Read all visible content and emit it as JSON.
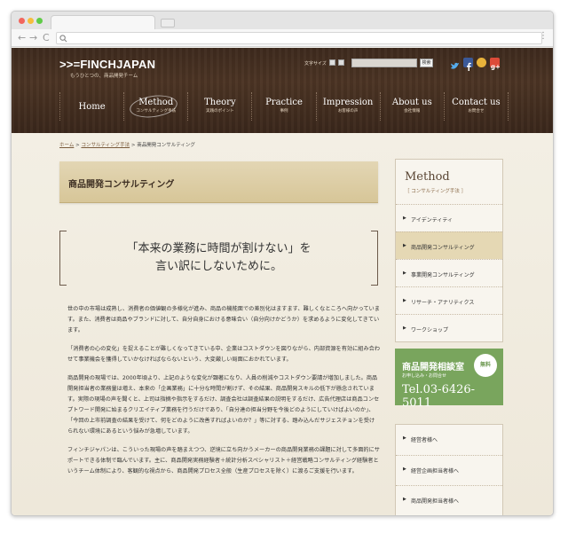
{
  "browser": {
    "back": "←",
    "forward": "→",
    "reload": "C"
  },
  "header": {
    "logo": ">>=FINCHJAPAN",
    "logo_sub": "もうひとつの、商品開発チーム",
    "font_size_label": "文字サイズ",
    "search_button": "検索",
    "nav": [
      {
        "en": "Home",
        "ja": ""
      },
      {
        "en": "Method",
        "ja": "コンサルティング手法"
      },
      {
        "en": "Theory",
        "ja": "実践のポイント"
      },
      {
        "en": "Practice",
        "ja": "事例"
      },
      {
        "en": "Impression",
        "ja": "お客様の声"
      },
      {
        "en": "About us",
        "ja": "会社情報"
      },
      {
        "en": "Contact us",
        "ja": "お問合せ"
      }
    ]
  },
  "breadcrumb": {
    "home": "ホーム",
    "sep1": " > ",
    "parent": "コンサルティング手法",
    "sep2": " > ",
    "current": "商品開発コンサルティング"
  },
  "main": {
    "title": "商品開発コンサルティング",
    "quote_line1": "「本来の業務に時間が割けない」を",
    "quote_line2": "言い訳にしないために。",
    "paragraphs": [
      "世の中の市場は成熟し、消費者の価値観の多様化が進み、商品の機能面での差別化はますます、難しくなところへ向かっています。また、消費者は商品やブランドに対して、自分自身における意味合い（自分向けかどうか）を求めるように変化してきています。",
      "「消費者の心の変化」を捉えることが難しくなってきている中、企業はコストダウンを図りながら、内部資源を有効に組み合わせて事業機会を獲得していかなければならないという、大変厳しい局面におかれています。",
      "商品開発の現場では、2000年頃より、上記のような変化が顕著になり、人員の削減やコストダウン要請が増加しました。商品開発担当者の業務量は増え、本来の「企画業務」に十分な時間が割けず、その結果、商品開発スキルの低下が懸念されています。実際の現場の声を聞くと、上司は指摘や指示をするだけ、調査会社は調査結果の説明をするだけ、広告代理店は商品コンセプトワード開発に始まるクリエイティブ業務を行うだけであり、「自分達の担当分野を今後どのようにしていけばよいのか」、「今回の上市前調査の結果を受けて、何をどのように改善すればよいのか？」等に対する、踏み込んだサジェスチョンを受けられない環境にあるという悩みが急増しています。",
      "フィンチジャパンは、こういった現場の声を踏まえつつ、逆境に立ち向かうメーカーの商品開発業務の課題に対して多面的にサポートできる体制で臨んでいます。主に、商品開発実務経験者＋統計分析スペシャリスト＋経営戦略コンサルティング経験者というチーム体制により、客観的な視点から、商品開発プロセス全般（生産プロセスを除く）に渡るご支援を行います。"
    ]
  },
  "sidebar": {
    "heading": "Method",
    "heading_sub": "［ コンサルティング手法 ］",
    "items": [
      {
        "label": "アイデンティティ"
      },
      {
        "label": "商品開発コンサルティング"
      },
      {
        "label": "事業開発コンサルティング"
      },
      {
        "label": "リサーチ・アナリティクス"
      },
      {
        "label": "ワークショップ"
      }
    ],
    "consult": {
      "title": "商品開発相談室",
      "sub": "お申し込み・お問合せ",
      "tel": "Tel.03-6426-5011",
      "badge": "無料"
    },
    "links": [
      {
        "label": "経営者様へ"
      },
      {
        "label": "経営企画担当者様へ"
      },
      {
        "label": "商品開発担当者様へ"
      }
    ]
  },
  "colors": {
    "header_bg": "#4a3324",
    "accent_green": "#79a55d",
    "title_bg": "#ddcfa8"
  }
}
